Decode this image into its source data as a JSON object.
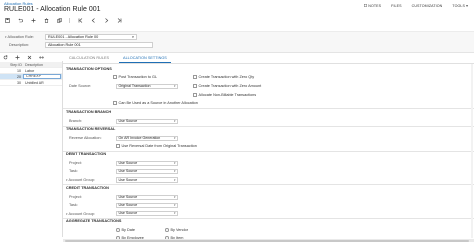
{
  "header": {
    "breadcrumb": "Allocation Rules",
    "title": "RULE001 - Allocation Rule 001",
    "right_menu": [
      "NOTES",
      "FILES",
      "CUSTOMIZATION",
      "TOOLS ▾"
    ]
  },
  "summary": {
    "rule_label": "Allocation Rule:",
    "rule_value": "RULE001 - Allocation Rule 00",
    "desc_label": "Description:",
    "desc_value": "Allocation Rule 001"
  },
  "left_grid": {
    "headers": [
      "",
      "Step ID",
      "Description"
    ],
    "rows": [
      {
        "step": "10",
        "desc": "Labor"
      },
      {
        "step": "20",
        "desc": "CHREXP"
      },
      {
        "step": "30",
        "desc": "Unbilled AR"
      }
    ],
    "selected_index": 1
  },
  "tabs": [
    "CALCULATION RULES",
    "ALLOCATION SETTINGS"
  ],
  "active_tab_index": 1,
  "transaction_options": {
    "title": "TRANSACTION OPTIONS",
    "post_to_gl": "Post Transaction to GL",
    "zero_qty": "Create Transaction with Zero Qty",
    "zero_amount": "Create Transaction with Zero Amount",
    "date_source_label": "Date Source:",
    "date_source_value": "Original Transaction",
    "allocate_nonbillable": "Allocate Non-Billable Transactions",
    "source_in_other": "Can Be Used as a Source in Another Allocation"
  },
  "transaction_branch": {
    "title": "TRANSACTION BRANCH",
    "branch_label": "Branch:",
    "branch_value": "Use Source"
  },
  "transaction_reversal": {
    "title": "TRANSACTION REVERSAL",
    "reversal_label": "Reverse Allocation:",
    "reversal_value": "On AR Invoice Generation",
    "use_reversal_date": "Use Reversal Date from Original Transaction"
  },
  "debit_transaction": {
    "title": "DEBIT TRANSACTION",
    "project_label": "Project:",
    "project_value": "Use Source",
    "task_label": "Task:",
    "task_value": "Use Source",
    "account_group_label": "Account Group:",
    "account_group_value": "Use Source"
  },
  "credit_transaction": {
    "title": "CREDIT TRANSACTION",
    "project_label": "Project:",
    "project_value": "Use Source",
    "task_label": "Task:",
    "task_value": "Use Source",
    "account_group_label": "Account Group:",
    "account_group_value": "Use Source"
  },
  "aggregate": {
    "title": "AGGREGATE TRANSACTIONS",
    "by_date": "By Date",
    "by_vendor": "By Vendor",
    "by_employee": "By Employee",
    "by_item": "By Item"
  },
  "icons": {
    "toolbar": [
      "save-icon",
      "undo-icon",
      "add-icon",
      "delete-icon",
      "copy-icon",
      "first-icon",
      "prev-icon",
      "next-icon",
      "last-icon"
    ]
  }
}
